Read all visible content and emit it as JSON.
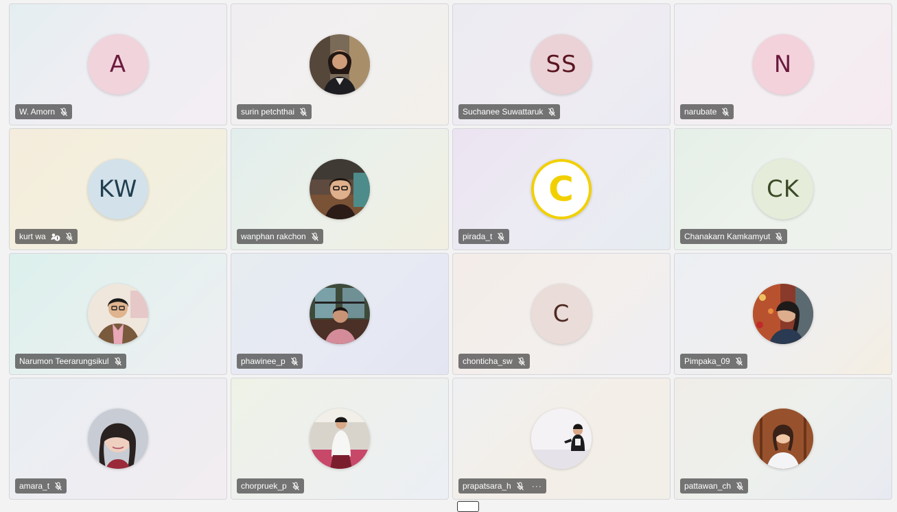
{
  "participants": [
    {
      "name": "W. Amorn",
      "initials": "A"
    },
    {
      "name": "surin petchthai",
      "initials": ""
    },
    {
      "name": "Suchanee Suwattaruk",
      "initials": "SS"
    },
    {
      "name": "narubate",
      "initials": "N"
    },
    {
      "name": "kurt wa",
      "initials": "KW"
    },
    {
      "name": "wanphan rakchon",
      "initials": ""
    },
    {
      "name": "pirada_t",
      "initials": "C"
    },
    {
      "name": "Chanakarn Kamkamyut",
      "initials": "CK"
    },
    {
      "name": "Narumon Teerarungsikul",
      "initials": ""
    },
    {
      "name": "phawinee_p",
      "initials": ""
    },
    {
      "name": "chonticha_sw",
      "initials": "C"
    },
    {
      "name": "Pimpaka_09",
      "initials": ""
    },
    {
      "name": "amara_t",
      "initials": ""
    },
    {
      "name": "chorpruek_p",
      "initials": ""
    },
    {
      "name": "prapatsara_h",
      "initials": ""
    },
    {
      "name": "pattawan_ch",
      "initials": ""
    }
  ],
  "more_options_label": "···",
  "icons": {
    "mic": "mic-muted-icon",
    "more": "more-options-icon",
    "badge": "participant-status-icon"
  }
}
